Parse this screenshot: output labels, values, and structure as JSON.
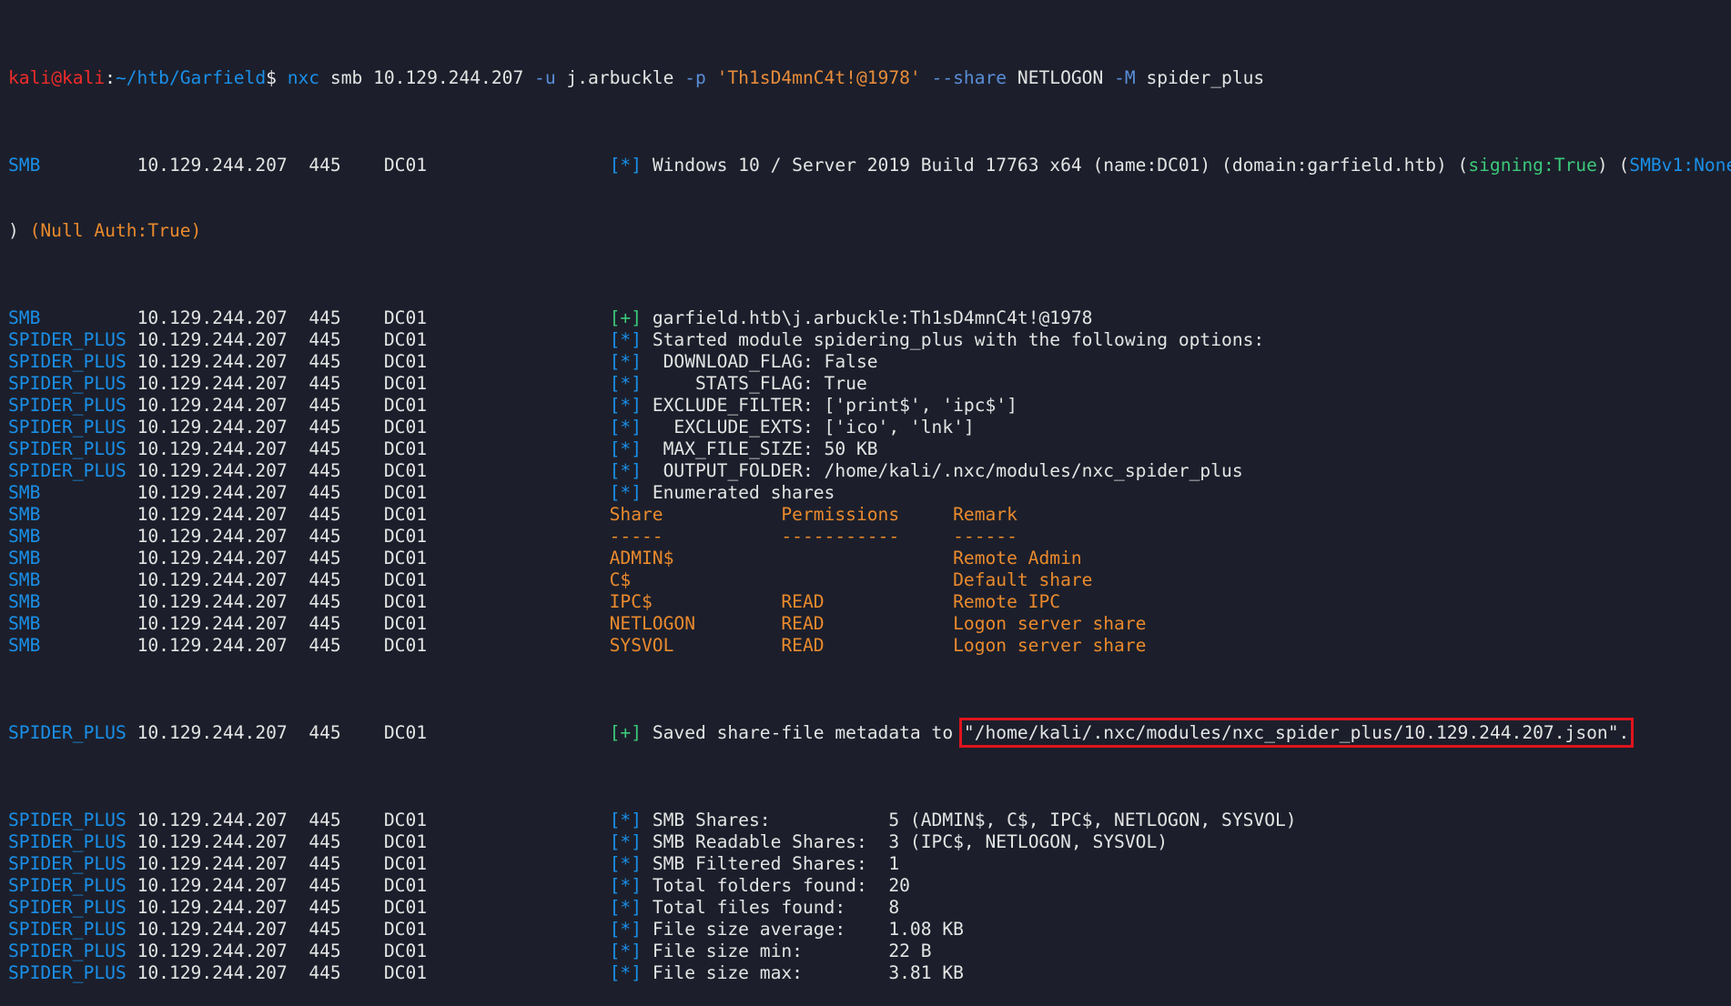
{
  "prompt": {
    "user": "kali",
    "at": "@",
    "host": "kali",
    "sep": ":",
    "path": "~/htb/Garfield",
    "symbol": "$"
  },
  "command": {
    "bin": "nxc",
    "proto": "smb",
    "target": "10.129.244.207",
    "u_flag": "-u",
    "user": "j.arbuckle",
    "p_flag": "-p",
    "password": "'Th1sD4mnC4t!@1978'",
    "share_flag": "--share",
    "share": "NETLOGON",
    "m_flag": "-M",
    "module": "spider_plus"
  },
  "host_info": {
    "ip": "10.129.244.207",
    "port": "445",
    "name": "DC01"
  },
  "banner": {
    "proto": "SMB",
    "tag": "[*]",
    "text": "Windows 10 / Server 2019 Build 17763 x64 (name:DC01) (domain:garfield.htb) (",
    "signing": "signing:True",
    "mid": ") (",
    "smbv1": "SMBv1:None",
    "cont_open": ") ",
    "null_auth": "(Null Auth:True)"
  },
  "lines": [
    {
      "proto": "SMB",
      "tag": "[+]",
      "tagc": "green",
      "text": "garfield.htb\\j.arbuckle:Th1sD4mnC4t!@1978",
      "textc": "white"
    },
    {
      "proto": "SPIDER_PLUS",
      "tag": "[*]",
      "tagc": "blue",
      "text": "Started module spidering_plus with the following options:",
      "textc": "white"
    },
    {
      "proto": "SPIDER_PLUS",
      "tag": "[*]",
      "tagc": "blue",
      "text": " DOWNLOAD_FLAG: False",
      "textc": "white"
    },
    {
      "proto": "SPIDER_PLUS",
      "tag": "[*]",
      "tagc": "blue",
      "text": "    STATS_FLAG: True",
      "textc": "white"
    },
    {
      "proto": "SPIDER_PLUS",
      "tag": "[*]",
      "tagc": "blue",
      "text": "EXCLUDE_FILTER: ['print$', 'ipc$']",
      "textc": "white"
    },
    {
      "proto": "SPIDER_PLUS",
      "tag": "[*]",
      "tagc": "blue",
      "text": "  EXCLUDE_EXTS: ['ico', 'lnk']",
      "textc": "white"
    },
    {
      "proto": "SPIDER_PLUS",
      "tag": "[*]",
      "tagc": "blue",
      "text": " MAX_FILE_SIZE: 50 KB",
      "textc": "white"
    },
    {
      "proto": "SPIDER_PLUS",
      "tag": "[*]",
      "tagc": "blue",
      "text": " OUTPUT_FOLDER: /home/kali/.nxc/modules/nxc_spider_plus",
      "textc": "white"
    },
    {
      "proto": "SMB",
      "tag": "[*]",
      "tagc": "blue",
      "text": "Enumerated shares",
      "textc": "white"
    },
    {
      "proto": "SMB",
      "tag": "",
      "tagc": "blue",
      "text": "Share           Permissions     Remark",
      "textc": "orange"
    },
    {
      "proto": "SMB",
      "tag": "",
      "tagc": "blue",
      "text": "-----           -----------     ------",
      "textc": "orange"
    },
    {
      "proto": "SMB",
      "tag": "",
      "tagc": "blue",
      "text": "ADMIN$                          Remote Admin",
      "textc": "orange"
    },
    {
      "proto": "SMB",
      "tag": "",
      "tagc": "blue",
      "text": "C$                              Default share",
      "textc": "orange"
    },
    {
      "proto": "SMB",
      "tag": "",
      "tagc": "blue",
      "text": "IPC$            READ            Remote IPC",
      "textc": "orange"
    },
    {
      "proto": "SMB",
      "tag": "",
      "tagc": "blue",
      "text": "NETLOGON        READ            Logon server share",
      "textc": "orange"
    },
    {
      "proto": "SMB",
      "tag": "",
      "tagc": "blue",
      "text": "SYSVOL          READ            Logon server share",
      "textc": "orange"
    }
  ],
  "saved": {
    "proto": "SPIDER_PLUS",
    "tag": "[+]",
    "text": "Saved share-file metadata to ",
    "path": "\"/home/kali/.nxc/modules/nxc_spider_plus/10.129.244.207.json\"."
  },
  "stats": [
    {
      "proto": "SPIDER_PLUS",
      "tag": "[*]",
      "text": "SMB Shares:           5 (ADMIN$, C$, IPC$, NETLOGON, SYSVOL)"
    },
    {
      "proto": "SPIDER_PLUS",
      "tag": "[*]",
      "text": "SMB Readable Shares:  3 (IPC$, NETLOGON, SYSVOL)"
    },
    {
      "proto": "SPIDER_PLUS",
      "tag": "[*]",
      "text": "SMB Filtered Shares:  1"
    },
    {
      "proto": "SPIDER_PLUS",
      "tag": "[*]",
      "text": "Total folders found:  20"
    },
    {
      "proto": "SPIDER_PLUS",
      "tag": "[*]",
      "text": "Total files found:    8"
    },
    {
      "proto": "SPIDER_PLUS",
      "tag": "[*]",
      "text": "File size average:    1.08 KB"
    },
    {
      "proto": "SPIDER_PLUS",
      "tag": "[*]",
      "text": "File size min:        22 B"
    },
    {
      "proto": "SPIDER_PLUS",
      "tag": "[*]",
      "text": "File size max:        3.81 KB"
    }
  ],
  "colors": {
    "background": "#1c1f2b",
    "prompt_user": "#ef2b2b",
    "path": "#1a8fe8",
    "tag_ok": "#3bc97a",
    "tag_info": "#1a8fe8",
    "share_table": "#ea8a2d",
    "highlight_box": "#e0141e"
  }
}
